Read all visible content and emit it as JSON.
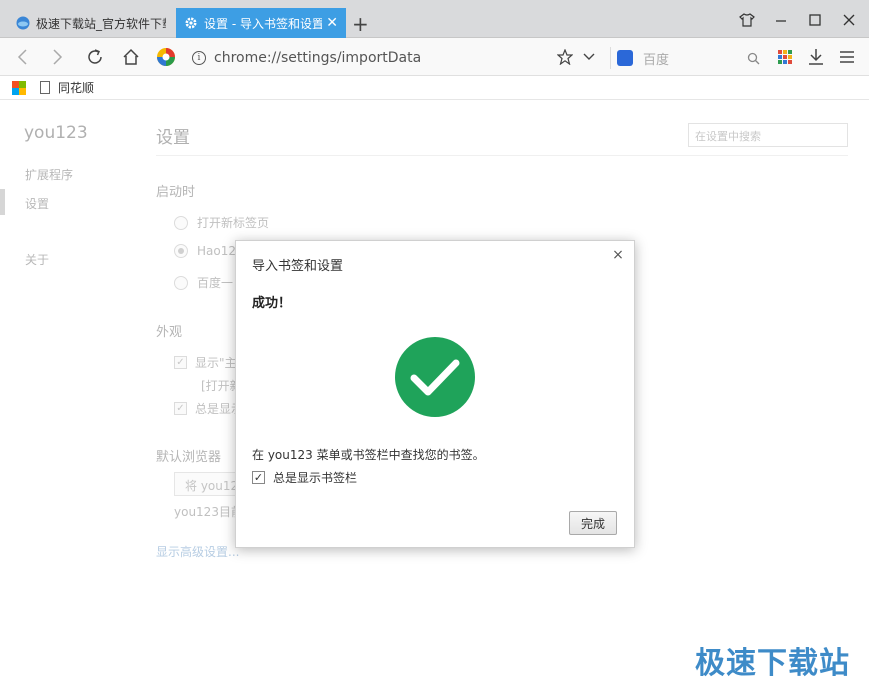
{
  "tabs": [
    {
      "title": "极速下载站_官方软件下载",
      "active": false
    },
    {
      "title": "设置 - 导入书签和设置",
      "active": true
    }
  ],
  "colors": {
    "active_tab": "#3d9ee4",
    "success_green": "#1fa35a",
    "watermark": "#2a7fc3"
  },
  "toolbar": {
    "url": "chrome://settings/importData",
    "search_placeholder": "百度",
    "icons": [
      "back-icon",
      "forward-icon",
      "reload-icon",
      "home-icon",
      "browser-logo-icon",
      "info-icon",
      "star-icon",
      "chevron-down-icon",
      "baidu-paw-icon",
      "search-icon",
      "apps-grid-icon",
      "download-icon",
      "menu-icon"
    ]
  },
  "window_icons": [
    "skin-icon",
    "minimize-icon",
    "maximize-icon",
    "close-icon"
  ],
  "bookmarks": {
    "items": [
      {
        "label": "同花顺"
      }
    ]
  },
  "sidebar": {
    "brand": "you123",
    "items": [
      {
        "label": "扩展程序"
      },
      {
        "label": "设置"
      },
      {
        "label": "关于"
      }
    ]
  },
  "settings": {
    "title": "设置",
    "search_placeholder": "在设置中搜索",
    "startup": {
      "heading": "启动时",
      "options": [
        "打开新标签页",
        "Hao123",
        "百度一"
      ]
    },
    "appearance": {
      "heading": "外观",
      "opt1": "显示\"主",
      "opt1_sub": "[打开新",
      "opt2": "总是显示"
    },
    "default_browser": {
      "heading": "默认浏览器",
      "button": "将 you123",
      "note": "you123目前"
    },
    "advanced_link": "显示高级设置..."
  },
  "dialog": {
    "title": "导入书签和设置",
    "close": "×",
    "success": "成功！",
    "message": "在 you123 菜单或书签栏中查找您的书签。",
    "checkbox_label": "总是显示书签栏",
    "checkbox_checked": true,
    "done_button": "完成"
  },
  "watermark": "极速下载站"
}
